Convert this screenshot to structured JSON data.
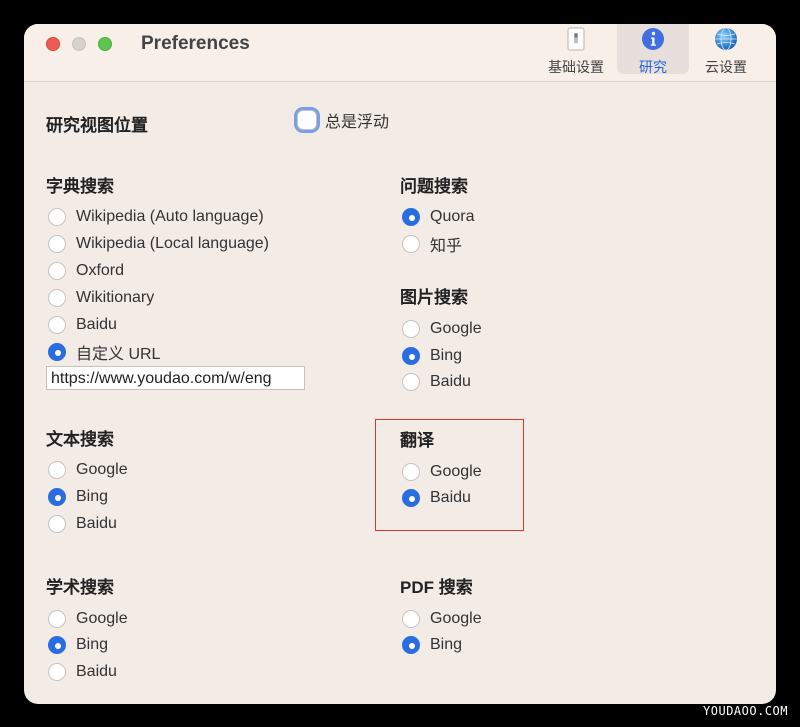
{
  "window": {
    "title": "Preferences",
    "tabs": [
      {
        "label": "基础设置",
        "icon": "switch-icon",
        "active": false
      },
      {
        "label": "研究",
        "icon": "info-icon",
        "active": true
      },
      {
        "label": "云设置",
        "icon": "globe-icon",
        "active": false
      }
    ]
  },
  "research_view": {
    "heading": "研究视图位置",
    "always_float_label": "总是浮动",
    "always_float_checked": false
  },
  "dictionary_search": {
    "heading": "字典搜索",
    "options": [
      "Wikipedia (Auto language)",
      "Wikipedia (Local language)",
      "Oxford",
      "Wikitionary",
      "Baidu",
      "自定义 URL"
    ],
    "selected": "自定义 URL",
    "custom_url": "https://www.youdao.com/w/eng"
  },
  "question_search": {
    "heading": "问题搜索",
    "options": [
      "Quora",
      "知乎"
    ],
    "selected": "Quora"
  },
  "image_search": {
    "heading": "图片搜索",
    "options": [
      "Google",
      "Bing",
      "Baidu"
    ],
    "selected": "Bing"
  },
  "text_search": {
    "heading": "文本搜索",
    "options": [
      "Google",
      "Bing",
      "Baidu"
    ],
    "selected": "Bing"
  },
  "translate": {
    "heading": "翻译",
    "options": [
      "Google",
      "Baidu"
    ],
    "selected": "Baidu"
  },
  "academic_search": {
    "heading": "学术搜索",
    "options": [
      "Google",
      "Bing",
      "Baidu"
    ],
    "selected": "Bing"
  },
  "pdf_search": {
    "heading": "PDF 搜索",
    "options": [
      "Google",
      "Bing"
    ],
    "selected": "Bing"
  },
  "watermark": "YOUDAOO.COM",
  "colors": {
    "accent": "#2a6de0",
    "highlight_border": "#e0352f"
  }
}
